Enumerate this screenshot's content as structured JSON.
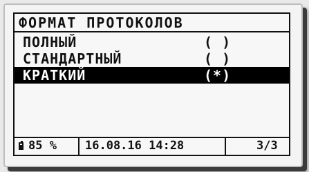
{
  "screen": {
    "title": "ФОРМАТ ПРОТОКОЛОВ",
    "options": [
      {
        "label": "ПОЛНЫЙ",
        "mark": "( )",
        "selected": false
      },
      {
        "label": "СТАНДАРТНЫЙ",
        "mark": "( )",
        "selected": false
      },
      {
        "label": "КРАТКИЙ",
        "mark": "(*)",
        "selected": true
      }
    ]
  },
  "status_bar": {
    "battery_icon": "battery-icon",
    "battery_level": "85 %",
    "datetime": "16.08.16 14:28",
    "page": "3/3"
  }
}
